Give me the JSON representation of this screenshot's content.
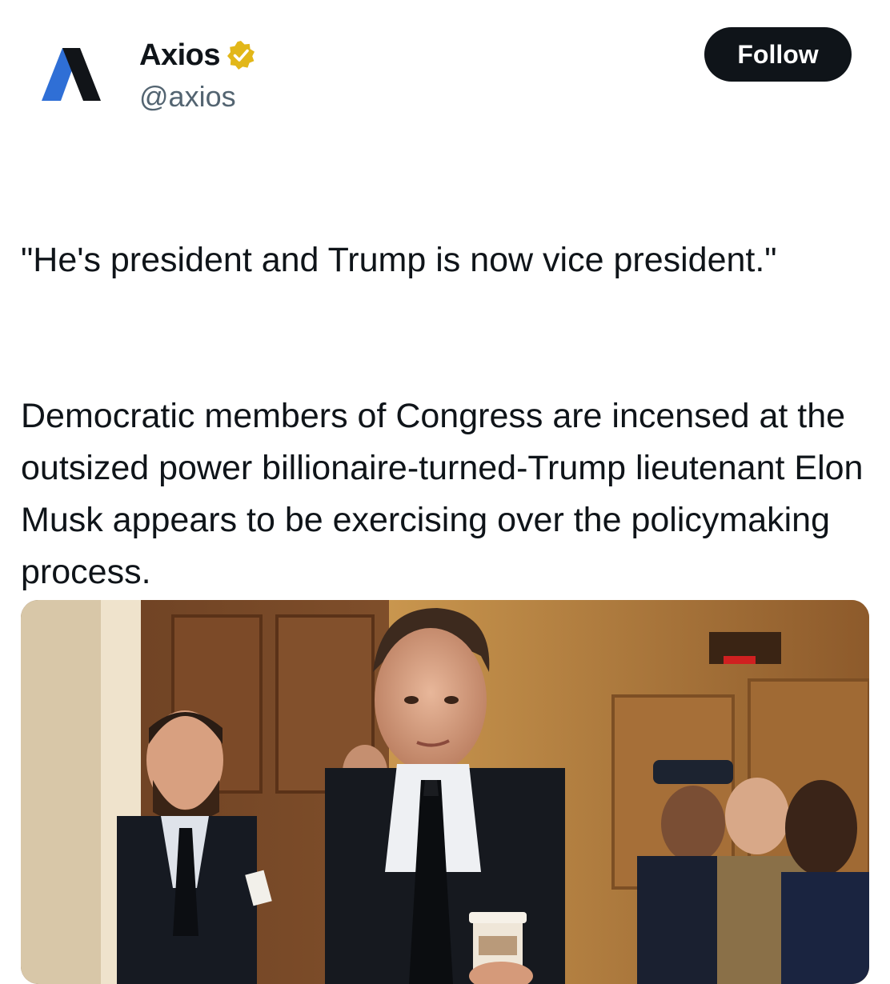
{
  "author": {
    "display_name": "Axios",
    "handle": "@axios",
    "verified_badge_icon": "gold-verified-badge-icon",
    "avatar_icon": "axios-logo-icon"
  },
  "follow_button": {
    "label": "Follow"
  },
  "post": {
    "paragraphs": [
      "\"He's president and Trump is now vice president.\"",
      "Democratic members of Congress are incensed at the outsized power billionaire-turned-Trump lieutenant Elon Musk appears to be exercising over the policymaking process."
    ]
  },
  "media": {
    "type": "photo"
  },
  "colors": {
    "follow_button_bg": "#0f1419",
    "handle_text": "#536471",
    "verified_gold": "#e2b719",
    "logo_blue": "#2f6fd6"
  }
}
